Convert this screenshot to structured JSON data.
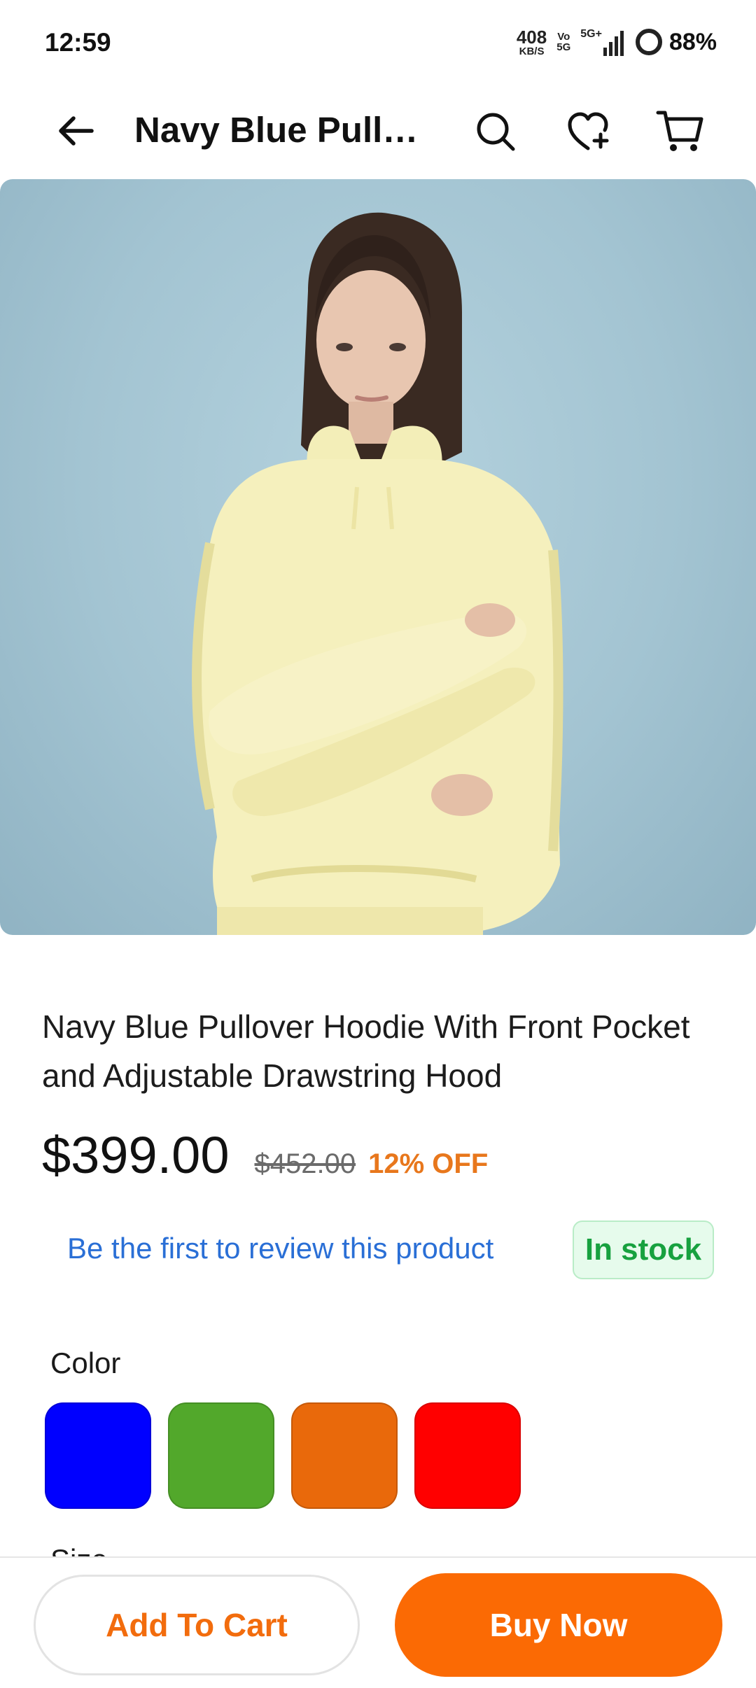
{
  "status_bar": {
    "time": "12:59",
    "net_speed": "408",
    "net_unit": "KB/S",
    "volte_top": "Vo",
    "volte_bottom": "5G",
    "signal_label": "5G+",
    "battery": "88%"
  },
  "app_bar": {
    "title": "Navy Blue Pullo…",
    "icons": [
      "back-arrow-icon",
      "search-icon",
      "wishlist-add-icon",
      "cart-icon"
    ]
  },
  "product": {
    "image_alt": "Woman wearing a pale yellow pullover hoodie with arms crossed",
    "title": "Navy Blue Pullover Hoodie With Front Pocket and Adjustable Drawstring Hood",
    "price": "$399.00",
    "old_price": "$452.00",
    "discount": "12% OFF",
    "review_prompt": "Be the first to review this product",
    "stock_status": "In stock"
  },
  "options": {
    "color_label": "Color",
    "colors": [
      {
        "name": "blue",
        "hex": "#0000ff"
      },
      {
        "name": "green",
        "hex": "#52a82b"
      },
      {
        "name": "orange",
        "hex": "#e9690b"
      },
      {
        "name": "red",
        "hex": "#ff0000"
      }
    ],
    "size_label": "Size"
  },
  "actions": {
    "add_to_cart": "Add To Cart",
    "buy_now": "Buy Now"
  },
  "colors": {
    "accent": "#fb6a04",
    "link": "#2a6fd6",
    "stock_green": "#17a13f",
    "discount": "#e8771c"
  }
}
